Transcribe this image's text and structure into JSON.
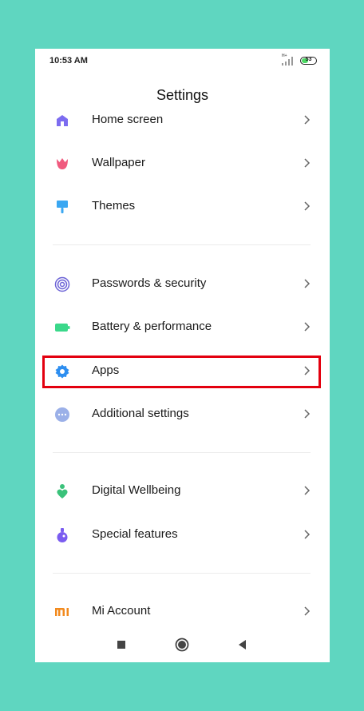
{
  "status_bar": {
    "time": "10:53 AM",
    "network": "H+",
    "battery_percent": "53",
    "battery_level": 0.53
  },
  "header": {
    "title": "Settings"
  },
  "settings": {
    "items": [
      {
        "label": "Home screen",
        "icon": "home-icon",
        "color": "#7c6cf0"
      },
      {
        "label": "Wallpaper",
        "icon": "tulip-icon",
        "color": "#f05a7e"
      },
      {
        "label": "Themes",
        "icon": "paintbrush-icon",
        "color": "#3aa7f2"
      },
      {
        "label": "Passwords & security",
        "icon": "fingerprint-icon",
        "color": "#6c63d6"
      },
      {
        "label": "Battery & performance",
        "icon": "battery-icon",
        "color": "#3ad88a"
      },
      {
        "label": "Apps",
        "icon": "gear-icon",
        "color": "#2d8ef0"
      },
      {
        "label": "Additional settings",
        "icon": "more-dots-icon",
        "color": "#9bb0e8"
      },
      {
        "label": "Digital Wellbeing",
        "icon": "person-heart-icon",
        "color": "#3ac27a"
      },
      {
        "label": "Special features",
        "icon": "flask-icon",
        "color": "#7a5cf0"
      },
      {
        "label": "Mi Account",
        "icon": "mi-logo-icon",
        "color": "#f28a1e"
      }
    ],
    "highlighted": "Apps"
  },
  "nav_bar": {
    "buttons": [
      "recents-button",
      "home-button",
      "back-button"
    ]
  },
  "colors": {
    "background": "#5fd6c0",
    "highlight": "#e3000f"
  }
}
